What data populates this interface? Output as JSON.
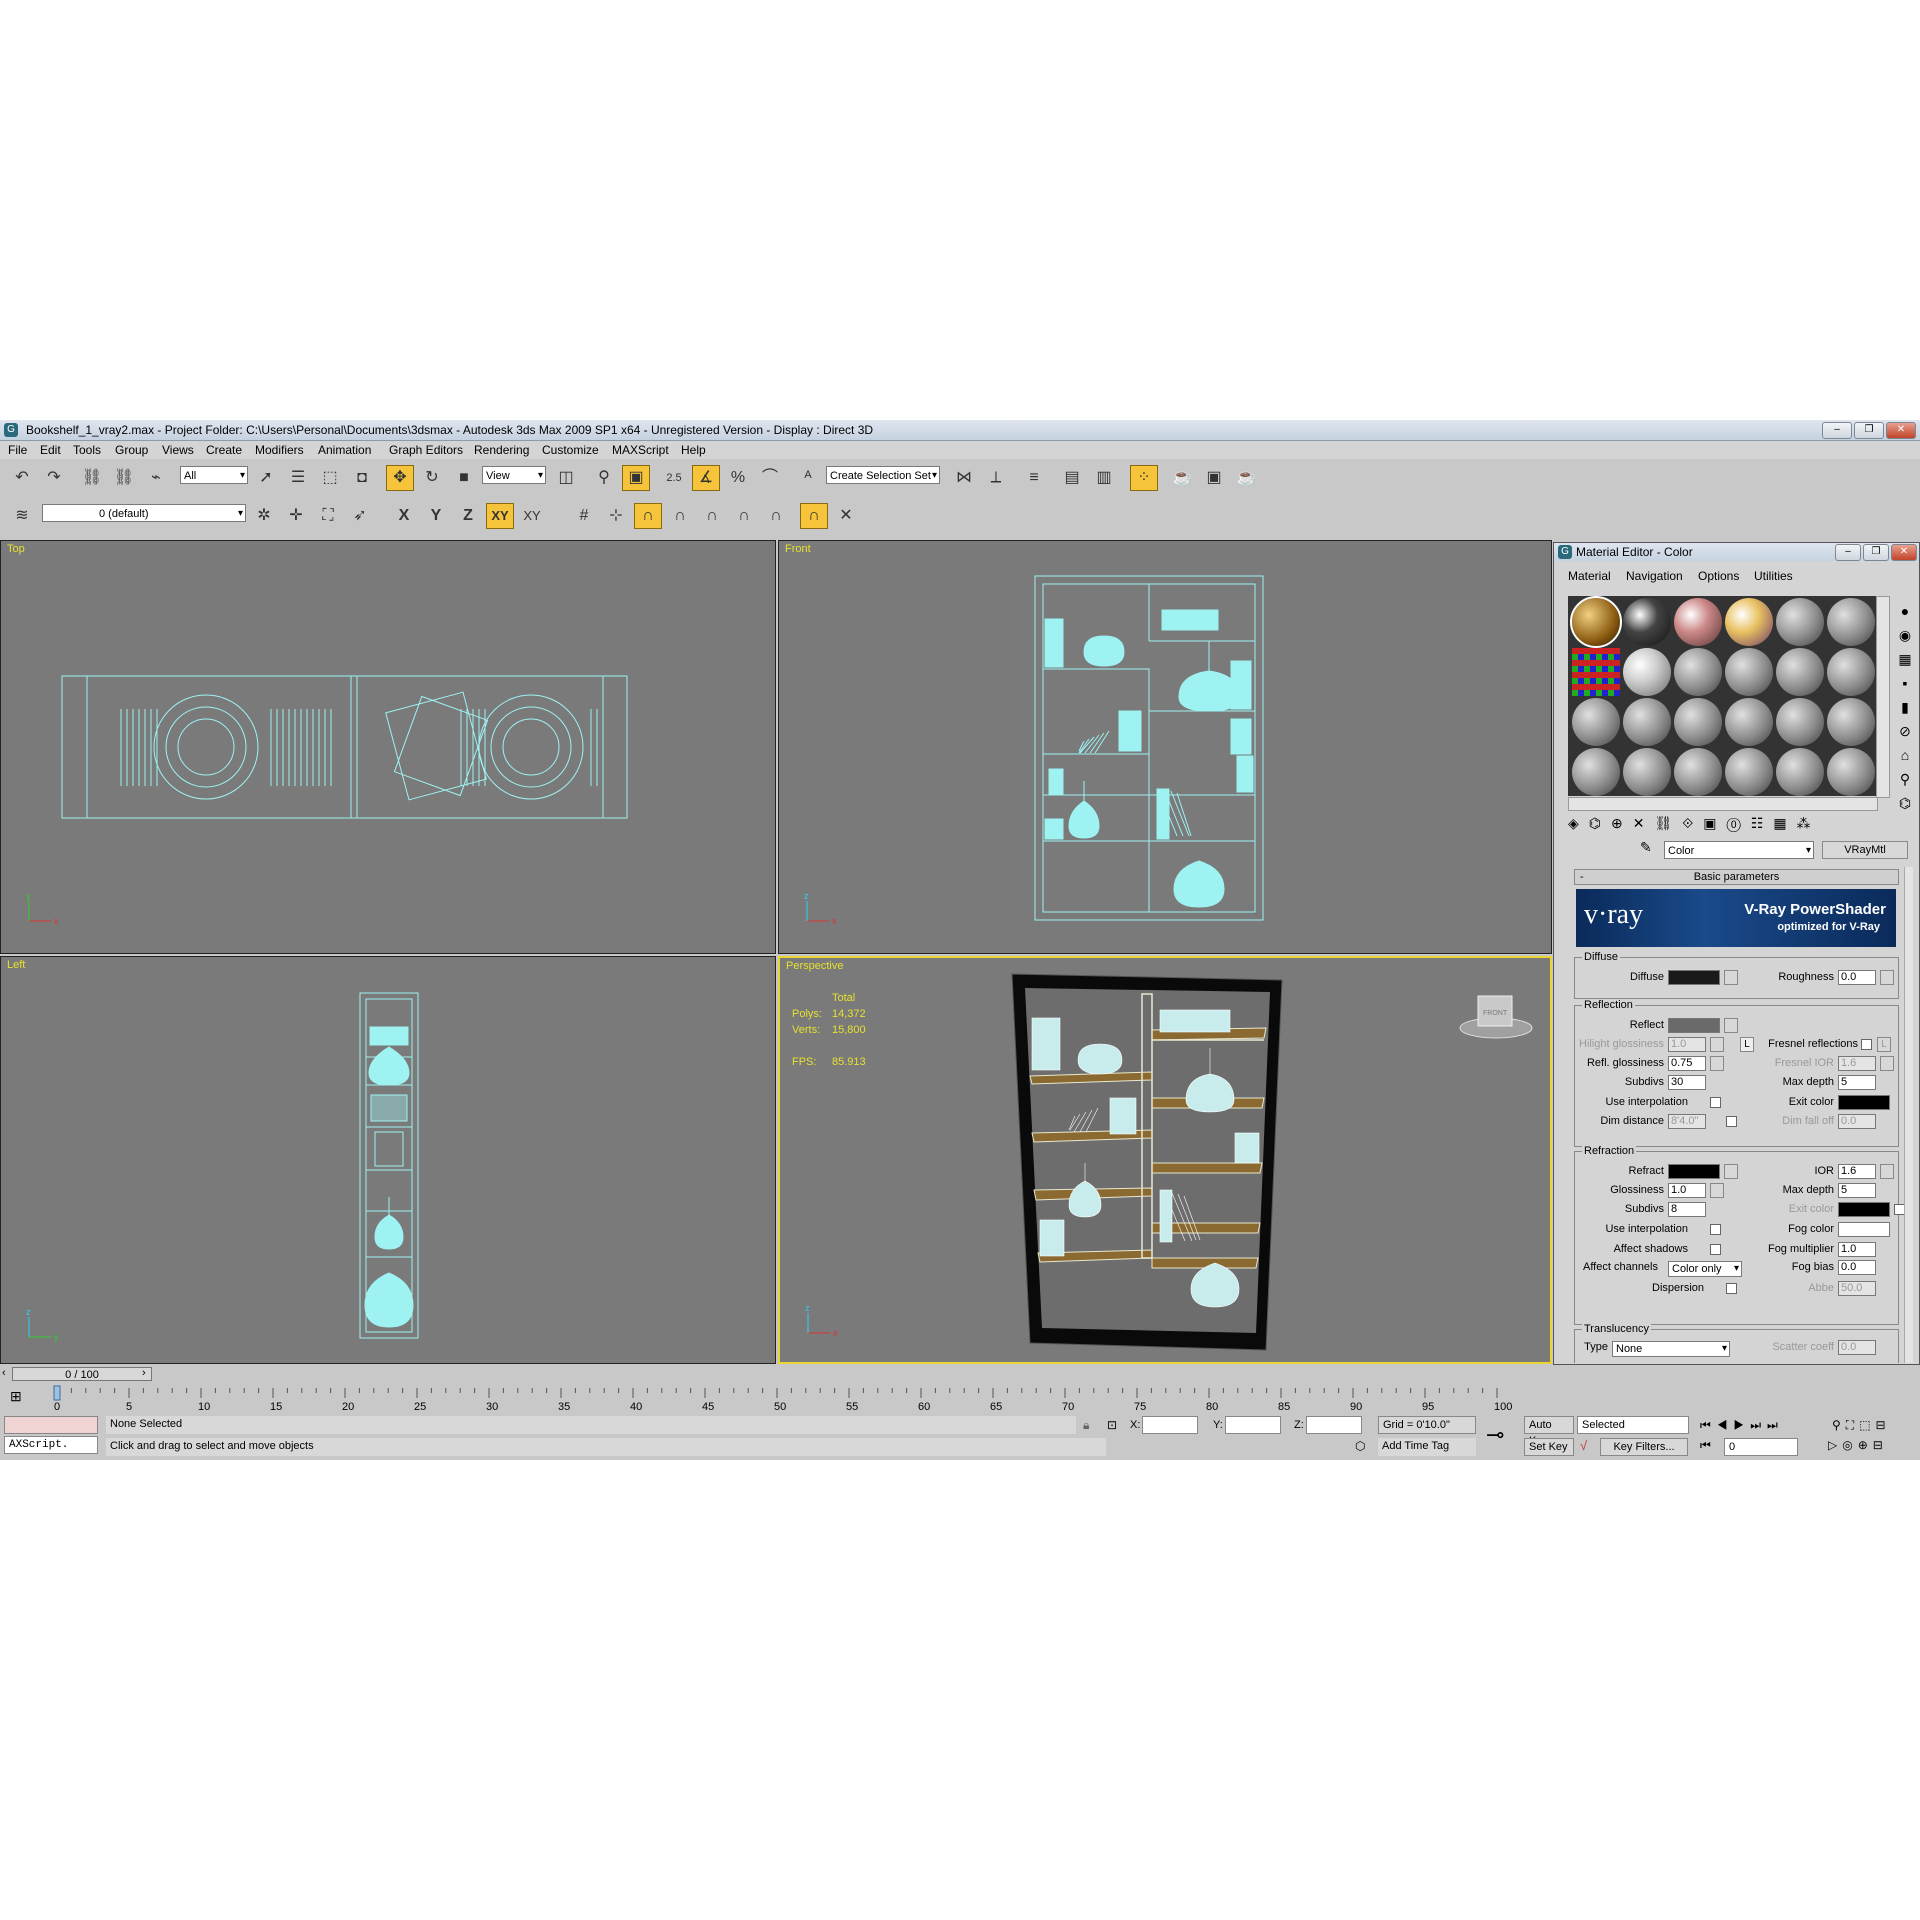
{
  "window": {
    "title": "Bookshelf_1_vray2.max     - Project Folder: C:\\Users\\Personal\\Documents\\3dsmax     - Autodesk 3ds Max  2009 SP1  x64  - Unregistered Version     - Display : Direct 3D",
    "icon": "3dsmax-icon",
    "buttons": [
      "–",
      "❐",
      "✕"
    ]
  },
  "menu": [
    "File",
    "Edit",
    "Tools",
    "Group",
    "Views",
    "Create",
    "Modifiers",
    "Animation",
    "Graph Editors",
    "Rendering",
    "Customize",
    "MAXScript",
    "Help"
  ],
  "toolbar": {
    "filter": "All",
    "reference": "View",
    "selection_set": "Create Selection Set",
    "snap_angle": "2.5",
    "snap_percent": "%"
  },
  "layers": {
    "current": "0 (default)",
    "axes": [
      "X",
      "Y",
      "Z",
      "XY",
      "XY"
    ]
  },
  "viewports": {
    "top": "Top",
    "front": "Front",
    "left": "Left",
    "perspective": "Perspective",
    "viewcube": "FRONT"
  },
  "stats": {
    "header": "Total",
    "polys_label": "Polys:",
    "polys": "14,372",
    "verts_label": "Verts:",
    "verts": "15,800",
    "fps_label": "FPS:",
    "fps": "85.913"
  },
  "timeline": {
    "position": "0 / 100",
    "ticks": [
      "0",
      "5",
      "10",
      "15",
      "20",
      "25",
      "30",
      "35",
      "40",
      "45",
      "50",
      "55",
      "60",
      "65",
      "70",
      "75",
      "80",
      "85",
      "90",
      "95",
      "100"
    ]
  },
  "status": {
    "maxscript": "AXScript.",
    "selection": "None Selected",
    "prompt": "Click and drag to select and move objects",
    "x_label": "X:",
    "y_label": "Y:",
    "z_label": "Z:",
    "grid": "Grid = 0'10.0\"",
    "add_time_tag": "Add Time Tag",
    "auto_key": "Auto Key",
    "set_key": "Set Key",
    "key_mode": "Selected",
    "key_filters": "Key Filters...",
    "frame": "0"
  },
  "material_editor": {
    "title": "Material Editor - Color",
    "menu": [
      "Material",
      "Navigation",
      "Options",
      "Utilities"
    ],
    "material_name": "Color",
    "material_type": "VRayMtl",
    "rollout": "Basic parameters",
    "rollout_toggle": "-",
    "banner_logo": "v·ray",
    "banner_title": "V-Ray PowerShader",
    "banner_sub": "optimized for V-Ray",
    "diffuse": {
      "group": "Diffuse",
      "diffuse_label": "Diffuse",
      "diffuse_color": "#1a1a1a",
      "roughness_label": "Roughness",
      "roughness": "0.0"
    },
    "reflection": {
      "group": "Reflection",
      "reflect_label": "Reflect",
      "reflect_color": "#6a6a6a",
      "hilight_label": "Hilight glossiness",
      "hilight": "1.0",
      "lock": "L",
      "fresnel_label": "Fresnel reflections",
      "fresnel_lock": "L",
      "refl_gloss_label": "Refl. glossiness",
      "refl_gloss": "0.75",
      "fresnel_ior_label": "Fresnel IOR",
      "fresnel_ior": "1.6",
      "subdivs_label": "Subdivs",
      "subdivs": "30",
      "max_depth_label": "Max depth",
      "max_depth": "5",
      "use_interp_label": "Use interpolation",
      "exit_color_label": "Exit color",
      "exit_color": "#000000",
      "dim_distance_label": "Dim distance",
      "dim_distance": "8'4.0\"",
      "dim_falloff_label": "Dim fall off",
      "dim_falloff": "0.0"
    },
    "refraction": {
      "group": "Refraction",
      "refract_label": "Refract",
      "refract_color": "#000000",
      "ior_label": "IOR",
      "ior": "1.6",
      "glossiness_label": "Glossiness",
      "glossiness": "1.0",
      "max_depth_label": "Max depth",
      "max_depth": "5",
      "subdivs_label": "Subdivs",
      "subdivs": "8",
      "exit_color_label": "Exit color",
      "exit_color": "#000000",
      "use_interp_label": "Use interpolation",
      "fog_color_label": "Fog color",
      "fog_color": "#ffffff",
      "affect_shadows_label": "Affect shadows",
      "fog_mult_label": "Fog multiplier",
      "fog_mult": "1.0",
      "affect_channels_label": "Affect channels",
      "affect_channels": "Color only",
      "fog_bias_label": "Fog bias",
      "fog_bias": "0.0",
      "dispersion_label": "Dispersion",
      "abbe_label": "Abbe",
      "abbe": "50.0"
    },
    "translucency": {
      "group": "Translucency",
      "type_label": "Type",
      "type": "None",
      "scatter_label": "Scatter coeff",
      "scatter": "0.0"
    }
  }
}
